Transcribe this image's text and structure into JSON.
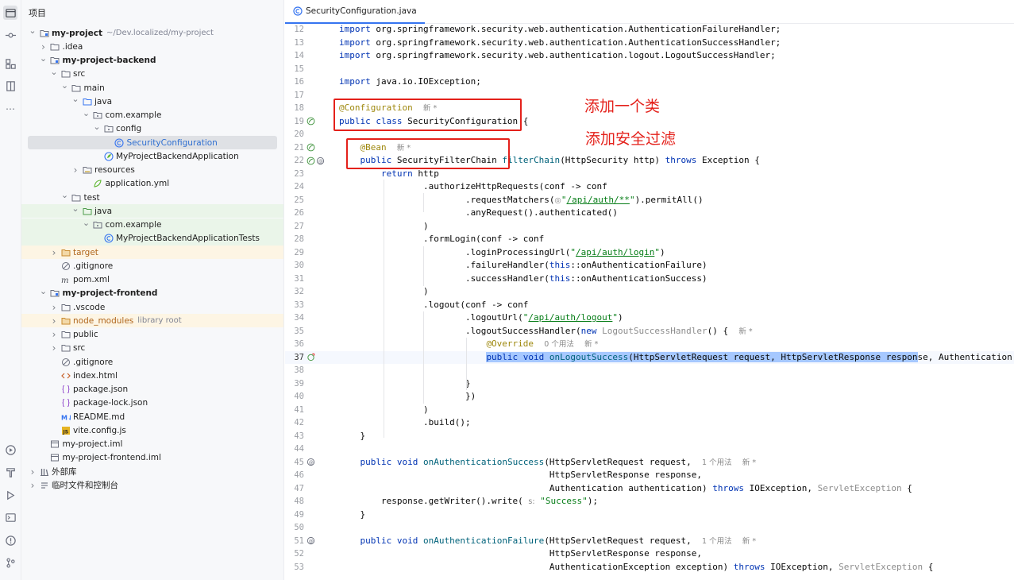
{
  "project_panel": {
    "title": "项目",
    "tree": [
      {
        "label": "my-project",
        "hint": "~/Dev.localized/my-project",
        "icon": "module-folder-icon",
        "depth": 0,
        "chev": "v",
        "bold": true
      },
      {
        "label": ".idea",
        "icon": "folder-icon",
        "depth": 1,
        "chev": ">"
      },
      {
        "label": "my-project-backend",
        "icon": "module-folder-icon",
        "depth": 1,
        "chev": "v",
        "bold": true
      },
      {
        "label": "src",
        "icon": "folder-icon",
        "depth": 2,
        "chev": "v"
      },
      {
        "label": "main",
        "icon": "folder-icon",
        "depth": 3,
        "chev": "v"
      },
      {
        "label": "java",
        "icon": "source-folder-icon",
        "depth": 4,
        "chev": "v"
      },
      {
        "label": "com.example",
        "icon": "package-icon",
        "depth": 5,
        "chev": "v"
      },
      {
        "label": "config",
        "icon": "package-icon",
        "depth": 6,
        "chev": "v"
      },
      {
        "label": "SecurityConfiguration",
        "icon": "java-class-icon",
        "depth": 7,
        "chev": "",
        "selected": true
      },
      {
        "label": "MyProjectBackendApplication",
        "icon": "spring-class-icon",
        "depth": 6,
        "chev": ""
      },
      {
        "label": "resources",
        "icon": "resources-folder-icon",
        "depth": 4,
        "chev": ">"
      },
      {
        "label": "application.yml",
        "icon": "yaml-file-icon",
        "depth": 5,
        "chev": ""
      },
      {
        "label": "test",
        "icon": "folder-icon",
        "depth": 3,
        "chev": "v"
      },
      {
        "label": "java",
        "icon": "test-folder-icon",
        "depth": 4,
        "chev": "v",
        "test": true
      },
      {
        "label": "com.example",
        "icon": "package-icon",
        "depth": 5,
        "chev": "v",
        "test": true
      },
      {
        "label": "MyProjectBackendApplicationTests",
        "icon": "java-class-icon",
        "depth": 6,
        "chev": "",
        "test": true
      },
      {
        "label": "target",
        "icon": "excluded-folder-icon",
        "depth": 2,
        "chev": ">",
        "excluded": true
      },
      {
        "label": ".gitignore",
        "icon": "gitignore-file-icon",
        "depth": 2,
        "chev": ""
      },
      {
        "label": "pom.xml",
        "icon": "maven-file-icon",
        "depth": 2,
        "chev": ""
      },
      {
        "label": "my-project-frontend",
        "icon": "module-folder-icon",
        "depth": 1,
        "chev": "v",
        "bold": true
      },
      {
        "label": ".vscode",
        "icon": "folder-icon",
        "depth": 2,
        "chev": ">"
      },
      {
        "label": "node_modules",
        "hint": "library root",
        "icon": "excluded-folder-icon",
        "depth": 2,
        "chev": ">",
        "excluded": true
      },
      {
        "label": "public",
        "icon": "folder-icon",
        "depth": 2,
        "chev": ">"
      },
      {
        "label": "src",
        "icon": "folder-icon",
        "depth": 2,
        "chev": ">"
      },
      {
        "label": ".gitignore",
        "icon": "gitignore-file-icon",
        "depth": 2,
        "chev": ""
      },
      {
        "label": "index.html",
        "icon": "html-file-icon",
        "depth": 2,
        "chev": ""
      },
      {
        "label": "package.json",
        "icon": "json-file-icon",
        "depth": 2,
        "chev": ""
      },
      {
        "label": "package-lock.json",
        "icon": "json-file-icon",
        "depth": 2,
        "chev": ""
      },
      {
        "label": "README.md",
        "icon": "markdown-file-icon",
        "depth": 2,
        "chev": ""
      },
      {
        "label": "vite.config.js",
        "icon": "js-file-icon",
        "depth": 2,
        "chev": ""
      },
      {
        "label": "my-project.iml",
        "icon": "iml-file-icon",
        "depth": 1,
        "chev": ""
      },
      {
        "label": "my-project-frontend.iml",
        "icon": "iml-file-icon",
        "depth": 1,
        "chev": ""
      },
      {
        "label": "外部库",
        "icon": "library-icon",
        "depth": 0,
        "chev": ">"
      },
      {
        "label": "临时文件和控制台",
        "icon": "scratches-icon",
        "depth": 0,
        "chev": ">"
      }
    ]
  },
  "editor": {
    "tab_label": "SecurityConfiguration.java",
    "lines": [
      {
        "n": "12",
        "html": "<span class='kw'>import</span> org.springframework.security.web.authentication.AuthenticationFailureHandler;"
      },
      {
        "n": "13",
        "html": "<span class='kw'>import</span> org.springframework.security.web.authentication.AuthenticationSuccessHandler;"
      },
      {
        "n": "14",
        "html": "<span class='kw'>import</span> org.springframework.security.web.authentication.logout.LogoutSuccessHandler;"
      },
      {
        "n": "15",
        "html": ""
      },
      {
        "n": "16",
        "html": "<span class='kw'>import</span> java.io.IOException;"
      },
      {
        "n": "17",
        "html": ""
      },
      {
        "n": "18",
        "html": "<span class='ann'>@Configuration</span>  <span class='hint'>新 *</span>"
      },
      {
        "n": "19",
        "html": "<span class='kw'>public class</span> SecurityConfiguration {",
        "gutter": [
          "bean-icon"
        ]
      },
      {
        "n": "20",
        "html": ""
      },
      {
        "n": "21",
        "html": "    <span class='ann'>@Bean</span>  <span class='hint'>新 *</span>",
        "gutter": [
          "bean-icon"
        ]
      },
      {
        "n": "22",
        "html": "    <span class='kw'>public</span> SecurityFilterChain <span class='fn'>filterChain</span>(HttpSecurity http) <span class='kw'>throws</span> Exception {",
        "gutter": [
          "bean-icon",
          "override-icon"
        ]
      },
      {
        "n": "23",
        "html": "        <span class='kw'>return</span> http"
      },
      {
        "n": "24",
        "html": "                .authorizeHttpRequests(conf -> conf"
      },
      {
        "n": "25",
        "html": "                        .requestMatchers(<span class='hint'>◎</span><span class='str'>\"</span><span class='strl'>/api/auth/**</span><span class='str'>\"</span>).permitAll()"
      },
      {
        "n": "26",
        "html": "                        .anyRequest().authenticated()"
      },
      {
        "n": "27",
        "html": "                )"
      },
      {
        "n": "28",
        "html": "                .formLogin(conf -> conf"
      },
      {
        "n": "29",
        "html": "                        .loginProcessingUrl(<span class='str'>\"</span><span class='strl'>/api/auth/login</span><span class='str'>\"</span>)"
      },
      {
        "n": "30",
        "html": "                        .failureHandler(<span class='kw'>this</span>::onAuthenticationFailure)"
      },
      {
        "n": "31",
        "html": "                        .successHandler(<span class='kw'>this</span>::onAuthenticationSuccess)"
      },
      {
        "n": "32",
        "html": "                )"
      },
      {
        "n": "33",
        "html": "                .logout(conf -> conf"
      },
      {
        "n": "34",
        "html": "                        .logoutUrl(<span class='str'>\"</span><span class='strl'>/api/auth/logout</span><span class='str'>\"</span>)"
      },
      {
        "n": "35",
        "html": "                        .logoutSuccessHandler(<span class='kw'>new</span> <span class='gray'>LogoutSuccessHandler</span>() {  <span class='hint'>新 *</span>"
      },
      {
        "n": "36",
        "html": "                            <span class='ann'>@Override</span>  <span class='hint'>0 个用法</span>  <span class='hint'>新 *</span>"
      },
      {
        "n": "37",
        "html": "                            <span class='hl'><span class='kw'>public void</span> <span class='fn'>onLogoutSuccess</span>(HttpServletRequest request, HttpServletResponse respon</span>se, Authentication",
        "gutter": [
          "implements-icon"
        ],
        "current": true
      },
      {
        "n": "38",
        "html": ""
      },
      {
        "n": "39",
        "html": "                        }"
      },
      {
        "n": "40",
        "html": "                        })"
      },
      {
        "n": "41",
        "html": "                )"
      },
      {
        "n": "42",
        "html": "                .build();"
      },
      {
        "n": "43",
        "html": "    }"
      },
      {
        "n": "44",
        "html": ""
      },
      {
        "n": "45",
        "html": "    <span class='kw'>public void</span> <span class='fn'>onAuthenticationSuccess</span>(HttpServletRequest request,  <span class='hint'>1 个用法</span>  <span class='hint'>新 *</span>",
        "gutter": [
          "override-icon"
        ]
      },
      {
        "n": "46",
        "html": "                                        HttpServletResponse response,"
      },
      {
        "n": "47",
        "html": "                                        Authentication authentication) <span class='kw'>throws</span> IOException, <span class='gray'>ServletException</span> {"
      },
      {
        "n": "48",
        "html": "        response.getWriter().write( <span class='hint'>s:</span> <span class='str'>\"Success\"</span>);"
      },
      {
        "n": "49",
        "html": "    }"
      },
      {
        "n": "50",
        "html": ""
      },
      {
        "n": "51",
        "html": "    <span class='kw'>public void</span> <span class='fn'>onAuthenticationFailure</span>(HttpServletRequest request,  <span class='hint'>1 个用法</span>  <span class='hint'>新 *</span>",
        "gutter": [
          "override-icon"
        ]
      },
      {
        "n": "52",
        "html": "                                        HttpServletResponse response,"
      },
      {
        "n": "53",
        "html": "                                        AuthenticationException exception) <span class='kw'>throws</span> IOException, <span class='gray'>ServletException</span> {"
      }
    ]
  },
  "annotations": {
    "add_class": "添加一个类",
    "add_filter": "添加安全过滤"
  }
}
